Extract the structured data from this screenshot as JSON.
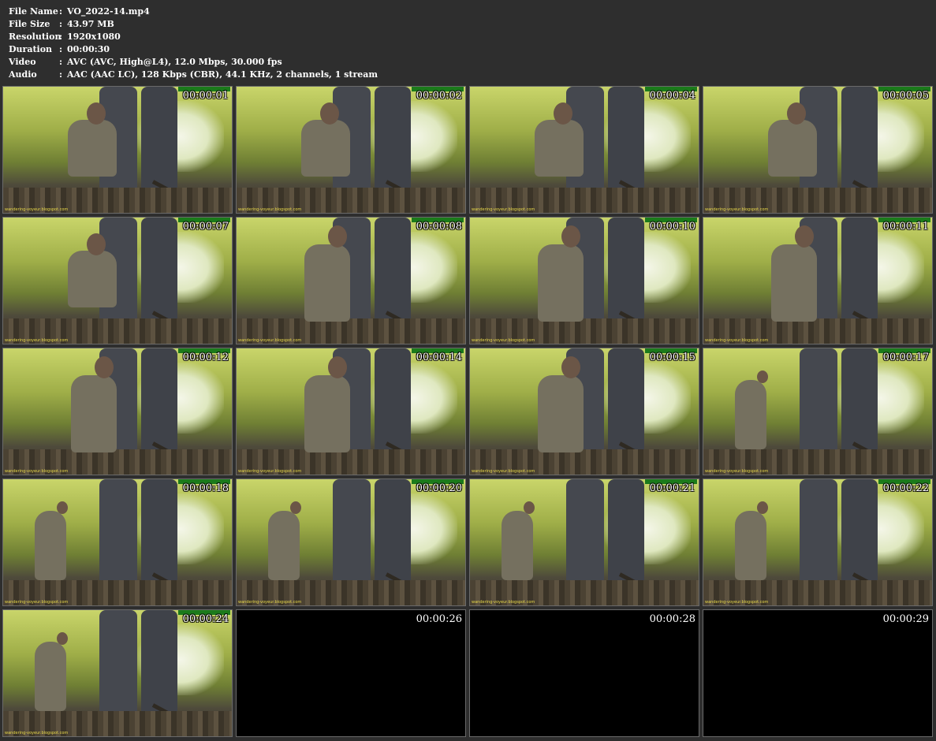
{
  "file_info": [
    {
      "key": "File Name",
      "value": "VO_2022-14.mp4"
    },
    {
      "key": "File Size",
      "value": "43.97 MB"
    },
    {
      "key": "Resolution",
      "value": "1920x1080"
    },
    {
      "key": "Duration",
      "value": "00:00:30"
    },
    {
      "key": "Video",
      "value": "AVC (AVC, High@L4), 12.0 Mbps, 30.000 fps"
    },
    {
      "key": "Audio",
      "value": "AAC (AAC LC), 128 Kbps (CBR), 44.1 KHz, 2 channels, 1 stream"
    }
  ],
  "separator": ":",
  "thumbnails": [
    {
      "time": "00:00:01",
      "pose": "squat",
      "frame": "image"
    },
    {
      "time": "00:00:02",
      "pose": "squat",
      "frame": "image"
    },
    {
      "time": "00:00:04",
      "pose": "squat",
      "frame": "image"
    },
    {
      "time": "00:00:05",
      "pose": "squat",
      "frame": "image"
    },
    {
      "time": "00:00:07",
      "pose": "squat",
      "frame": "image"
    },
    {
      "time": "00:00:08",
      "pose": "stand",
      "frame": "image"
    },
    {
      "time": "00:00:10",
      "pose": "stand",
      "frame": "image"
    },
    {
      "time": "00:00:11",
      "pose": "stand",
      "frame": "image"
    },
    {
      "time": "00:00:12",
      "pose": "stand",
      "frame": "image"
    },
    {
      "time": "00:00:14",
      "pose": "stand",
      "frame": "image"
    },
    {
      "time": "00:00:15",
      "pose": "stand",
      "frame": "image"
    },
    {
      "time": "00:00:17",
      "pose": "walk",
      "frame": "image"
    },
    {
      "time": "00:00:18",
      "pose": "walk",
      "frame": "image"
    },
    {
      "time": "00:00:20",
      "pose": "walk",
      "frame": "image"
    },
    {
      "time": "00:00:21",
      "pose": "walk",
      "frame": "image"
    },
    {
      "time": "00:00:22",
      "pose": "walk",
      "frame": "image"
    },
    {
      "time": "00:00:24",
      "pose": "walk",
      "frame": "image"
    },
    {
      "time": "00:00:26",
      "pose": "none",
      "frame": "black"
    },
    {
      "time": "00:00:28",
      "pose": "none",
      "frame": "black"
    },
    {
      "time": "00:00:29",
      "pose": "none",
      "frame": "black"
    }
  ],
  "watermark": "wandering-voyeur.blogspot.com"
}
